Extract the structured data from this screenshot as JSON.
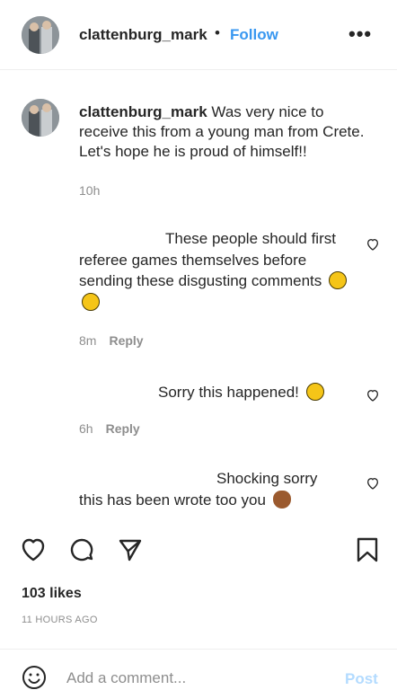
{
  "header": {
    "username": "clattenburg_mark",
    "separator": "•",
    "follow_label": "Follow",
    "more_label": "•••"
  },
  "caption": {
    "username": "clattenburg_mark",
    "text": "Was very nice to receive this from a young man from Crete. Let's hope he is proud of himself!!",
    "time": "10h"
  },
  "comments": [
    {
      "text": "These people should first referee games themselves before sending these disgusting comments",
      "emojis": [
        "tired-face-emoji",
        "grinning-face-emoji"
      ],
      "time": "8m",
      "reply_label": "Reply"
    },
    {
      "text": "Sorry this happened!",
      "emojis": [
        "sad-face-emoji"
      ],
      "time": "6h",
      "reply_label": "Reply"
    },
    {
      "text": "Shocking sorry this has been wrote too you",
      "emojis": [
        "see-no-evil-monkey-emoji"
      ]
    }
  ],
  "actions": {
    "icons": [
      "heart-icon",
      "comment-icon",
      "share-icon",
      "bookmark-icon"
    ]
  },
  "likes": "103 likes",
  "posted_ago": "11 HOURS AGO",
  "add_comment": {
    "placeholder": "Add a comment...",
    "post_label": "Post"
  },
  "colors": {
    "accent": "#3897f0",
    "muted": "#8e8e8e",
    "post_disabled": "#b3dbff"
  }
}
